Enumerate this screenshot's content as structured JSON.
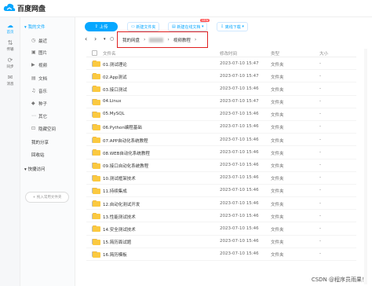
{
  "app": {
    "title": "百度网盘"
  },
  "rail": [
    {
      "label": "首页",
      "icon": "cloud-icon",
      "glyph": "☁"
    },
    {
      "label": "传输",
      "icon": "transfer-icon",
      "glyph": "⇅"
    },
    {
      "label": "同步",
      "icon": "sync-icon",
      "glyph": "⟳"
    },
    {
      "label": "消息",
      "icon": "message-icon",
      "glyph": "✉"
    }
  ],
  "sidebar": {
    "my_files": "我的文件",
    "items": [
      {
        "label": "最近",
        "icon": "clock-icon",
        "glyph": "◷"
      },
      {
        "label": "图片",
        "icon": "image-icon",
        "glyph": "▣"
      },
      {
        "label": "视频",
        "icon": "video-icon",
        "glyph": "▶"
      },
      {
        "label": "文档",
        "icon": "document-icon",
        "glyph": "▤"
      },
      {
        "label": "音乐",
        "icon": "music-icon",
        "glyph": "♫"
      },
      {
        "label": "种子",
        "icon": "seed-icon",
        "glyph": "◆"
      },
      {
        "label": "其它",
        "icon": "other-icon",
        "glyph": "⋯"
      },
      {
        "label": "隐藏空间",
        "icon": "lock-icon",
        "glyph": "⊡"
      }
    ],
    "my_share": "我的分享",
    "recycle": "回收站",
    "quick_access": "快捷访问",
    "quick_add": "+ 拖入常用文件夹"
  },
  "toolbar": {
    "upload": "上传",
    "new_folder": "新建文件夹",
    "new_online_doc": "新建在线文档",
    "new_badge": "NEW",
    "offline_download": "离线下载"
  },
  "breadcrumb": {
    "root": "我的网盘",
    "current": "视频教程"
  },
  "table": {
    "headers": {
      "name": "文件名",
      "time": "修改时间",
      "type": "类型",
      "size": "大小"
    },
    "rows": [
      {
        "name": "01.测试理论",
        "time": "2023-07-10 15:47",
        "type": "文件夹",
        "size": "-"
      },
      {
        "name": "02.App测试",
        "time": "2023-07-10 15:47",
        "type": "文件夹",
        "size": "-"
      },
      {
        "name": "03.接口测试",
        "time": "2023-07-10 15:46",
        "type": "文件夹",
        "size": "-"
      },
      {
        "name": "04.Linux",
        "time": "2023-07-10 15:47",
        "type": "文件夹",
        "size": "-"
      },
      {
        "name": "05.MySQL",
        "time": "2023-07-10 15:46",
        "type": "文件夹",
        "size": "-"
      },
      {
        "name": "06.Python编程基础",
        "time": "2023-07-10 15:46",
        "type": "文件夹",
        "size": "-"
      },
      {
        "name": "07.APP自动化系统教程",
        "time": "2023-07-10 15:46",
        "type": "文件夹",
        "size": "-"
      },
      {
        "name": "08.WEB自动化系统教程",
        "time": "2023-07-10 15:46",
        "type": "文件夹",
        "size": "-"
      },
      {
        "name": "09.接口自动化系统教程",
        "time": "2023-07-10 15:46",
        "type": "文件夹",
        "size": "-"
      },
      {
        "name": "10.测试框架技术",
        "time": "2023-07-10 15:46",
        "type": "文件夹",
        "size": "-"
      },
      {
        "name": "11.持续集成",
        "time": "2023-07-10 15:46",
        "type": "文件夹",
        "size": "-"
      },
      {
        "name": "12.自动化测试开发",
        "time": "2023-07-10 15:46",
        "type": "文件夹",
        "size": "-"
      },
      {
        "name": "13.性能测试技术",
        "time": "2023-07-10 15:46",
        "type": "文件夹",
        "size": "-"
      },
      {
        "name": "14.安全测试技术",
        "time": "2023-07-10 15:46",
        "type": "文件夹",
        "size": "-"
      },
      {
        "name": "15.简历面试题",
        "time": "2023-07-10 15:46",
        "type": "文件夹",
        "size": "-"
      },
      {
        "name": "16.简历模板",
        "time": "2023-07-10 15:46",
        "type": "文件夹",
        "size": "-"
      }
    ]
  },
  "watermark": "CSDN @程序员雨果！",
  "colors": {
    "accent": "#06a7ff",
    "folder": "#fbc940",
    "highlight_border": "#e02020"
  }
}
